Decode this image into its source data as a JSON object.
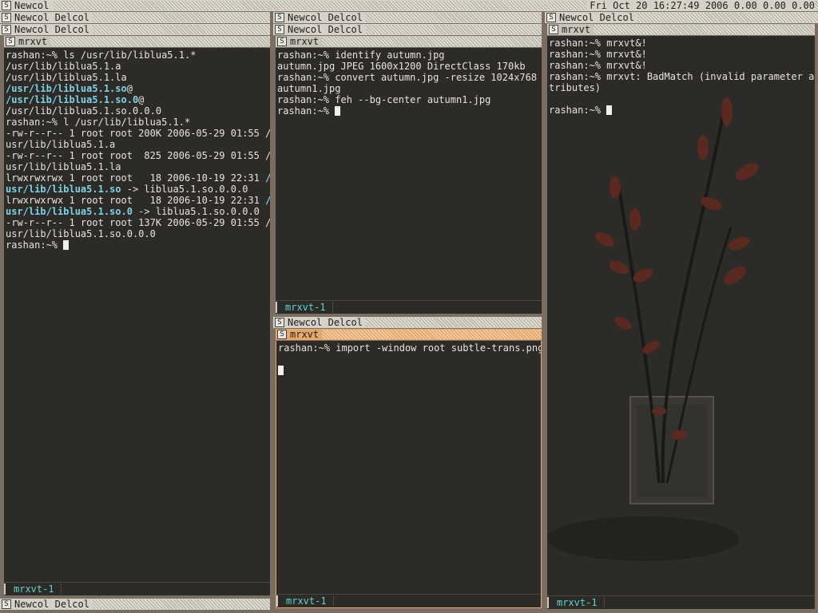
{
  "top_bar": {
    "label": "Newcol",
    "clock": "Fri Oct 20 16:27:49 2006 0.00 0.00 0.00"
  },
  "column_header": {
    "left": "Newcol",
    "right": "Delcol"
  },
  "column_icon": "S",
  "columns": {
    "left": {
      "window_title": "mrxvt",
      "tab": "mrxvt-1",
      "bottom_header": {
        "left": "Newcol",
        "right": "Delcol"
      },
      "lines": [
        [
          {
            "t": "rashan:~% ls /usr/lib/liblua5.1.*"
          }
        ],
        [
          {
            "t": "/usr/lib/liblua5.1.a"
          }
        ],
        [
          {
            "t": "/usr/lib/liblua5.1.la"
          }
        ],
        [
          {
            "t": "/usr/lib/liblua5.1.so",
            "c": "hl"
          },
          {
            "t": "@"
          }
        ],
        [
          {
            "t": "/usr/lib/liblua5.1.so.0",
            "c": "hl"
          },
          {
            "t": "@"
          }
        ],
        [
          {
            "t": "/usr/lib/liblua5.1.so.0.0.0"
          }
        ],
        [
          {
            "t": "rashan:~% l /usr/lib/liblua5.1.*"
          }
        ],
        [
          {
            "t": "-rw-r--r-- 1 root root 200K 2006-05-29 01:55 /"
          }
        ],
        [
          {
            "t": "usr/lib/liblua5.1.a"
          }
        ],
        [
          {
            "t": "-rw-r--r-- 1 root root  825 2006-05-29 01:55 /"
          }
        ],
        [
          {
            "t": "usr/lib/liblua5.1.la"
          }
        ],
        [
          {
            "t": "lrwxrwxrwx 1 root root   18 2006-10-19 22:31 "
          },
          {
            "t": "/",
            "c": "hl"
          }
        ],
        [
          {
            "t": "usr/lib/liblua5.1.so",
            "c": "hl"
          },
          {
            "t": " -> liblua5.1.so.0.0.0"
          }
        ],
        [
          {
            "t": "lrwxrwxrwx 1 root root   18 2006-10-19 22:31 "
          },
          {
            "t": "/",
            "c": "hl"
          }
        ],
        [
          {
            "t": "usr/lib/liblua5.1.so.0",
            "c": "hl"
          },
          {
            "t": " -> liblua5.1.so.0.0.0"
          }
        ],
        [
          {
            "t": "-rw-r--r-- 1 root root 137K 2006-05-29 01:55 /"
          }
        ],
        [
          {
            "t": "usr/lib/liblua5.1.so.0.0.0"
          }
        ],
        [
          {
            "t": "rashan:~% "
          },
          {
            "cursor": true
          }
        ]
      ]
    },
    "middle_top": {
      "window_title": "mrxvt",
      "tab": "mrxvt-1",
      "lines": [
        [
          {
            "t": "rashan:~% identify autumn.jpg"
          }
        ],
        [
          {
            "t": "autumn.jpg JPEG 1600x1200 DirectClass 170kb"
          }
        ],
        [
          {
            "t": "rashan:~% convert autumn.jpg -resize 1024x768"
          }
        ],
        [
          {
            "t": "autumn1.jpg"
          }
        ],
        [
          {
            "t": "rashan:~% feh --bg-center autumn1.jpg"
          }
        ],
        [
          {
            "t": "rashan:~% "
          },
          {
            "cursor": true
          }
        ]
      ]
    },
    "middle_bottom": {
      "window_title": "mrxvt",
      "tab": "mrxvt-1",
      "header": {
        "left": "Newcol",
        "right": "Delcol"
      },
      "lines": [
        [
          {
            "t": "rashan:~% import -window root subtle-trans.png"
          }
        ],
        [
          {
            "t": ""
          }
        ],
        [
          {
            "cursor": true
          }
        ]
      ]
    },
    "right": {
      "window_title": "mrxvt",
      "tab": "mrxvt-1",
      "lines": [
        [
          {
            "t": "rashan:~% mrxvt&!"
          }
        ],
        [
          {
            "t": "rashan:~% mrxvt&!"
          }
        ],
        [
          {
            "t": "rashan:~% mrxvt&!"
          }
        ],
        [
          {
            "t": "rashan:~% mrxvt: BadMatch (invalid parameter at"
          }
        ],
        [
          {
            "t": "tributes)"
          }
        ],
        [
          {
            "t": ""
          }
        ],
        [
          {
            "t": "rashan:~% "
          },
          {
            "cursor": true
          }
        ]
      ]
    }
  },
  "colors": {
    "terminal_bg": "#2d2b27",
    "highlight": "#7fd2e6",
    "focus": "#e4a86a",
    "tab_text": "#5fd3d0"
  },
  "icons": {
    "window_icon": "s-box-icon",
    "wallpaper": "vase-with-branches"
  }
}
